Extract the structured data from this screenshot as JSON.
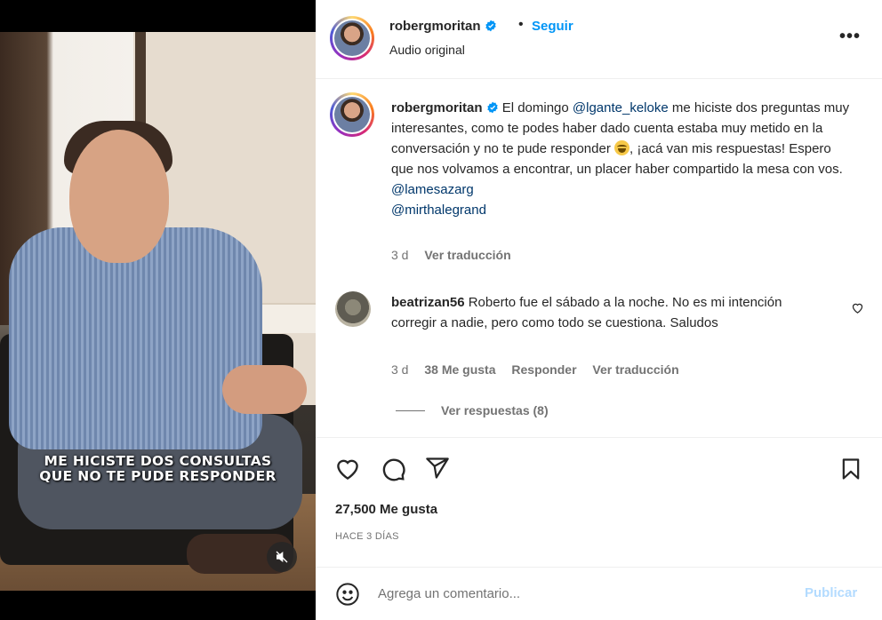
{
  "colors": {
    "accent": "#0095f6",
    "link": "#00376b",
    "muted": "#737373",
    "publish_disabled": "#b3dbff"
  },
  "video": {
    "caption_line1": "ME HICISTE DOS CONSULTAS",
    "caption_line2": "QUE NO TE PUDE RESPONDER",
    "mute_icon": "speaker-muted-icon"
  },
  "header": {
    "username": "robergmoritan",
    "separator": "•",
    "follow_label": "Seguir",
    "audio_label": "Audio original",
    "more_label": "•••"
  },
  "post": {
    "username": "robergmoritan",
    "text_part1": "El domingo ",
    "mention1": "@lgante_keloke",
    "text_part2": " me hiciste dos preguntas muy interesantes, como te podes haber dado cuenta estaba muy metido en la conversación y no te pude responder ",
    "emoji_icon": "laughing-tears-emoji-icon",
    "text_part3": ", ¡acá van mis respuestas! Espero que nos volvamos a encontrar, un placer haber compartido la mesa con vos.",
    "mention2": "@lamesazarg",
    "mention3": "@mirthalegrand",
    "time": "3 d",
    "translate_label": "Ver traducción"
  },
  "comment": {
    "username": "beatrizan56",
    "text": "Roberto fue el sábado a la noche. No es mi intención corregir a nadie, pero como todo se cuestiona. Saludos",
    "time": "3 d",
    "likes": "38 Me gusta",
    "reply_label": "Responder",
    "translate_label": "Ver traducción",
    "view_replies": "Ver respuestas (8)"
  },
  "actions": {
    "like_icon": "heart-icon",
    "comment_icon": "comment-icon",
    "share_icon": "send-icon",
    "save_icon": "bookmark-icon"
  },
  "stats": {
    "likes": "27,500 Me gusta",
    "posted": "HACE 3 DÍAS"
  },
  "add_comment": {
    "emoji_icon": "smiley-icon",
    "placeholder": "Agrega un comentario...",
    "publish_label": "Publicar"
  }
}
